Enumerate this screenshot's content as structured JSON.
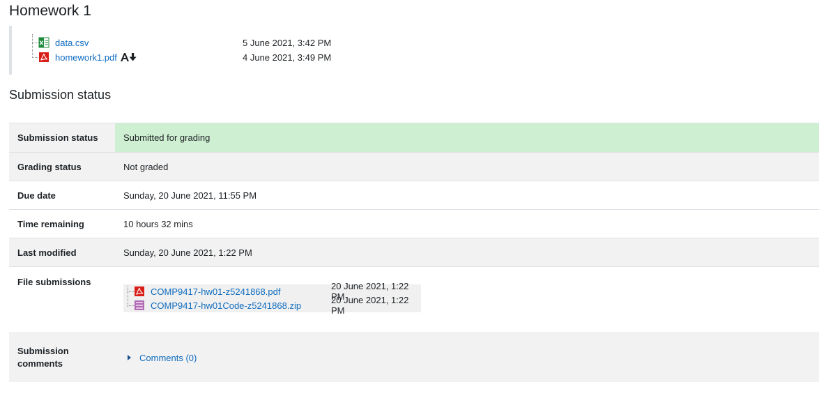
{
  "page": {
    "title": "Homework 1"
  },
  "intro_files": [
    {
      "name": "data.csv",
      "date": "5 June 2021, 3:42 PM",
      "icon": "spreadsheet-icon"
    },
    {
      "name": "homework1.pdf",
      "date": "4 June 2021, 3:49 PM",
      "icon": "pdf-icon",
      "extra_icon": "accessibility-download-icon"
    }
  ],
  "submission": {
    "heading": "Submission status",
    "rows": {
      "status": {
        "label": "Submission status",
        "value": "Submitted for grading"
      },
      "grading": {
        "label": "Grading status",
        "value": "Not graded"
      },
      "due": {
        "label": "Due date",
        "value": "Sunday, 20 June 2021, 11:55 PM"
      },
      "remaining": {
        "label": "Time remaining",
        "value": "10 hours 32 mins"
      },
      "modified": {
        "label": "Last modified",
        "value": "Sunday, 20 June 2021, 1:22 PM"
      },
      "files": {
        "label": "File submissions",
        "items": [
          {
            "name": "COMP9417-hw01-z5241868.pdf",
            "date": "20 June 2021, 1:22 PM",
            "icon": "pdf-icon"
          },
          {
            "name": "COMP9417-hw01Code-z5241868.zip",
            "date": "20 June 2021, 1:22 PM",
            "icon": "archive-icon"
          }
        ]
      },
      "comments": {
        "label_line1": "Submission",
        "label_line2": "comments",
        "link": "Comments (0)"
      }
    }
  },
  "colors": {
    "link": "#0f6cbf",
    "submitted_bg": "#cfefd2",
    "row_alt_bg": "#f2f2f2",
    "pdf_red": "#d91e18",
    "csv_green": "#1d8a3a",
    "zip_purple": "#b06ab3"
  }
}
